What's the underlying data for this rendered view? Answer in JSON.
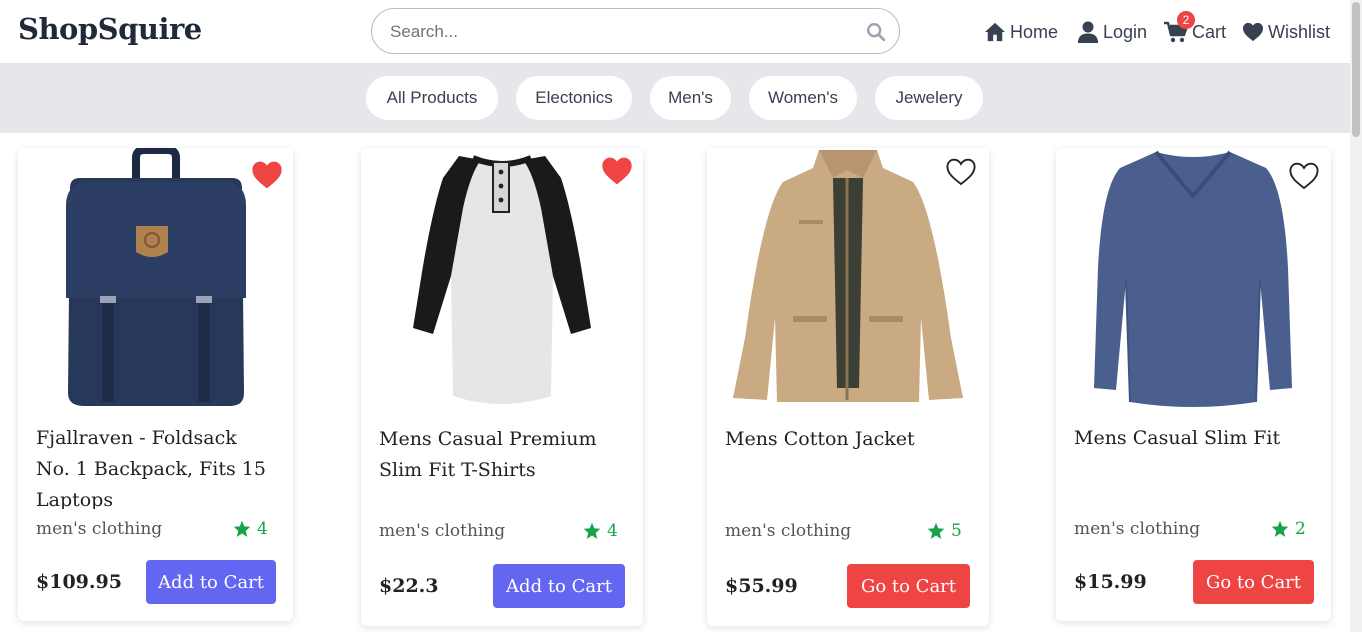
{
  "brand": "ShopSquire",
  "search": {
    "placeholder": "Search..."
  },
  "nav": {
    "home": "Home",
    "login": "Login",
    "cart": "Cart",
    "cart_count": "2",
    "wishlist": "Wishlist"
  },
  "categories": [
    "All Products",
    "Electonics",
    "Men's",
    "Women's",
    "Jewelery"
  ],
  "colors": {
    "accent": "#6366f1",
    "danger": "#ef4444",
    "rating": "#16a34a"
  },
  "products": [
    {
      "title": "Fjallraven - Foldsack No. 1 Backpack, Fits 15 Laptops",
      "category": "men's clothing",
      "rating": "4",
      "price": "$109.95",
      "button": "Add to Cart",
      "wishlisted": true,
      "image_icon": "backpack-image"
    },
    {
      "title": "Mens Casual Premium Slim Fit T-Shirts",
      "category": "men's clothing",
      "rating": "4",
      "price": "$22.3",
      "button": "Add to Cart",
      "wishlisted": true,
      "image_icon": "raglan-shirt-image"
    },
    {
      "title": "Mens Cotton Jacket",
      "category": "men's clothing",
      "rating": "5",
      "price": "$55.99",
      "button": "Go to Cart",
      "wishlisted": false,
      "image_icon": "jacket-image"
    },
    {
      "title": "Mens Casual Slim Fit",
      "category": "men's clothing",
      "rating": "2",
      "price": "$15.99",
      "button": "Go to Cart",
      "wishlisted": false,
      "image_icon": "long-sleeve-shirt-image"
    }
  ]
}
